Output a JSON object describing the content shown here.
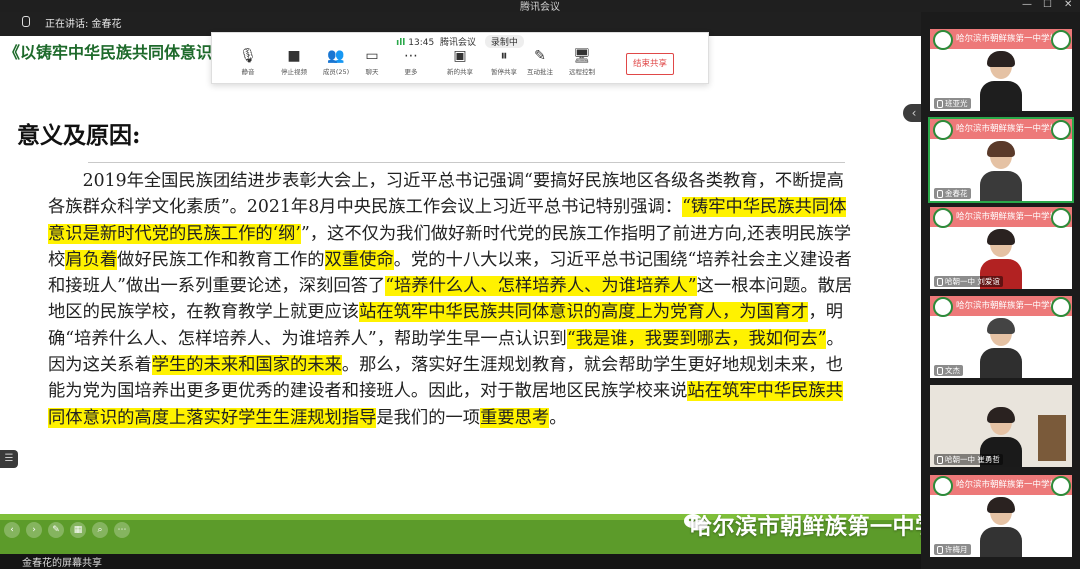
{
  "window": {
    "title": "腾讯会议"
  },
  "speaking": {
    "label": "正在讲话: 金春花"
  },
  "toolbar": {
    "time": "13:45",
    "app": "腾讯会议",
    "recording": "录制中",
    "items": [
      {
        "label": "静音",
        "icon": "mic-icon"
      },
      {
        "label": "停止视频",
        "icon": "camera-icon"
      },
      {
        "label": "成员(25)",
        "icon": "members-icon"
      },
      {
        "label": "聊天",
        "icon": "chat-icon"
      },
      {
        "label": "更多",
        "icon": "more-icon"
      },
      {
        "label": "新的共享",
        "icon": "share-icon"
      },
      {
        "label": "暂停共享",
        "icon": "pause-icon"
      },
      {
        "label": "互动批注",
        "icon": "annotate-icon"
      },
      {
        "label": "远程控制",
        "icon": "remote-control-icon"
      }
    ],
    "stop_share": "结束共享"
  },
  "slide": {
    "title": "《以铸牢中华民族共同体意识为引领 落实好学生生涯规划指导》——散居地区民族学校德育育现状",
    "heading": "意义及原因:",
    "runs": [
      {
        "text": "2019年全国民族团结进步表彰大会上，习近平总书记强调“要搞好民族地区各级各类教育，不断提高各族群众科学文化素质”。2021年8月中央民族工作会议上习近平总书记特别强调：",
        "hl": false
      },
      {
        "text": "“铸牢中华民族共同体意识是新时代党的民族工作的‘纲’",
        "hl": true
      },
      {
        "text": "”，这不仅为我们做好新时代党的民族工作指明了前进方向,还表明民族学校",
        "hl": false
      },
      {
        "text": "肩负着",
        "hl": true
      },
      {
        "text": "做好民族工作和教育工作的",
        "hl": false
      },
      {
        "text": "双重使命",
        "hl": true
      },
      {
        "text": "。党的十八大以来，习近平总书记围绕“培养社会主义建设者和接班人”做出一系列重要论述，深刻回答了",
        "hl": false
      },
      {
        "text": "“培养什么人、怎样培养人、为谁培养人”",
        "hl": true
      },
      {
        "text": "这一根本问题。散居地区的民族学校，在教育教学上就更应该",
        "hl": false
      },
      {
        "text": "站在筑牢中华民族共同体意识的高度上为党育人，为国育才",
        "hl": true
      },
      {
        "text": "，明确“培养什么人、怎样培养人、为谁培养人”，帮助学生早一点认识到",
        "hl": false
      },
      {
        "text": "“我是谁，我要到哪去，我如何去”",
        "hl": true
      },
      {
        "text": "。因为这关系着",
        "hl": false
      },
      {
        "text": "学生的未来和国家的未来",
        "hl": true
      },
      {
        "text": "。那么，落实好生涯规划教育，就会帮助学生更好地规划未来，也能为党为国培养出更多更优秀的建设者和接班人。因此，对于散居地区民族学校来说",
        "hl": false
      },
      {
        "text": "站在筑牢中华民族共同体意识的高度上落实好学生生涯规划指导",
        "hl": true
      },
      {
        "text": "是我们的一项",
        "hl": false
      },
      {
        "text": "重要思考",
        "hl": true
      },
      {
        "text": "。",
        "hl": false
      }
    ]
  },
  "watermark": "哈尔滨市朝鲜族第一中学校",
  "status": {
    "label": "金春花的屏幕共享"
  },
  "participants": [
    {
      "name": "班亚光",
      "band": "哈尔滨市朝鲜族第一中学校"
    },
    {
      "name": "金春花",
      "band": "哈尔滨市朝鲜族第一中学校"
    },
    {
      "name": "哈朝一中 刘爱谊",
      "band": "哈尔滨市朝鲜族第一中学校"
    },
    {
      "name": "文杰",
      "band": "哈尔滨市朝鲜族第一中学校"
    },
    {
      "name": "哈朝一中 崔勇哲",
      "band": "哈尔滨市朝鲜族第一中学校"
    },
    {
      "name": "许梅月",
      "band": "哈尔滨市朝鲜族第一中学校"
    }
  ],
  "colors": {
    "highlight": "#fff200",
    "slide_green": "#5c9b2a",
    "tile_band": "#ed7979"
  }
}
